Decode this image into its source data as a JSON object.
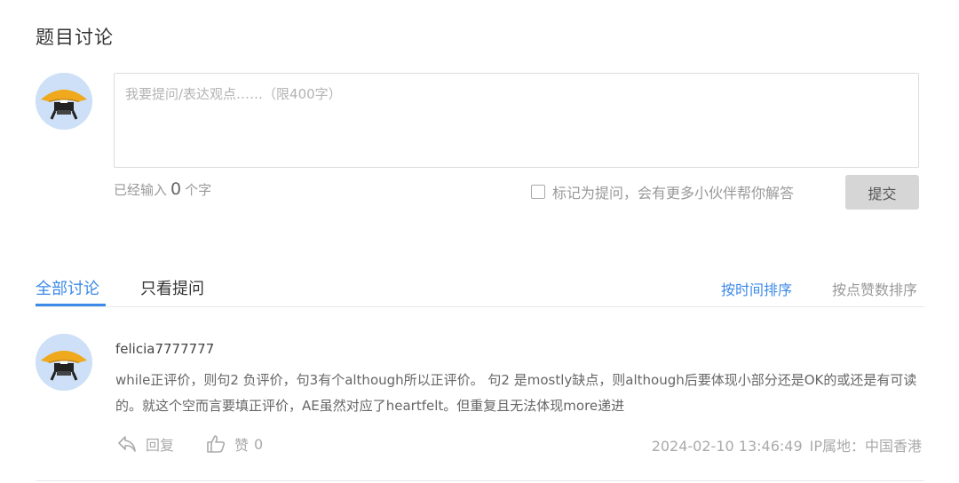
{
  "discussion": {
    "title": "题目讨论",
    "input": {
      "placeholder": "我要提问/表达观点……（限400字）",
      "value": ""
    },
    "char_count": {
      "prefix": "已经输入",
      "count": "0",
      "suffix": "个字"
    },
    "question_checkbox_label": "标记为提问，会有更多小伙伴帮你解答",
    "submit_label": "提交"
  },
  "tabs": {
    "all_label": "全部讨论",
    "questions_label": "只看提问"
  },
  "sort": {
    "by_time": "按时间排序",
    "by_likes": "按点赞数排序"
  },
  "comments": [
    {
      "user": "felicia7777777",
      "text": "while正评价，则句2 负评价，句3有个although所以正评价。 句2 是mostly缺点，则although后要体现小部分还是OK的或还是有可读的。就这个空而言要填正评价，AE虽然对应了heartfelt。但重复且无法体现more递进",
      "reply_label": "回复",
      "like_label": "赞",
      "like_count": "0",
      "timestamp": "2024-02-10 13:46:49",
      "ip_location": "IP属地：中国香港"
    }
  ],
  "colors": {
    "accent": "#3d8ae8",
    "avatar_bg": "#cde0f7",
    "hat": "#f0a81c",
    "button_bg": "#d6d6d6"
  },
  "icons": {
    "avatar": "ninja-hat-avatar",
    "reply": "reply-arrow-icon",
    "like": "thumbs-up-icon"
  }
}
